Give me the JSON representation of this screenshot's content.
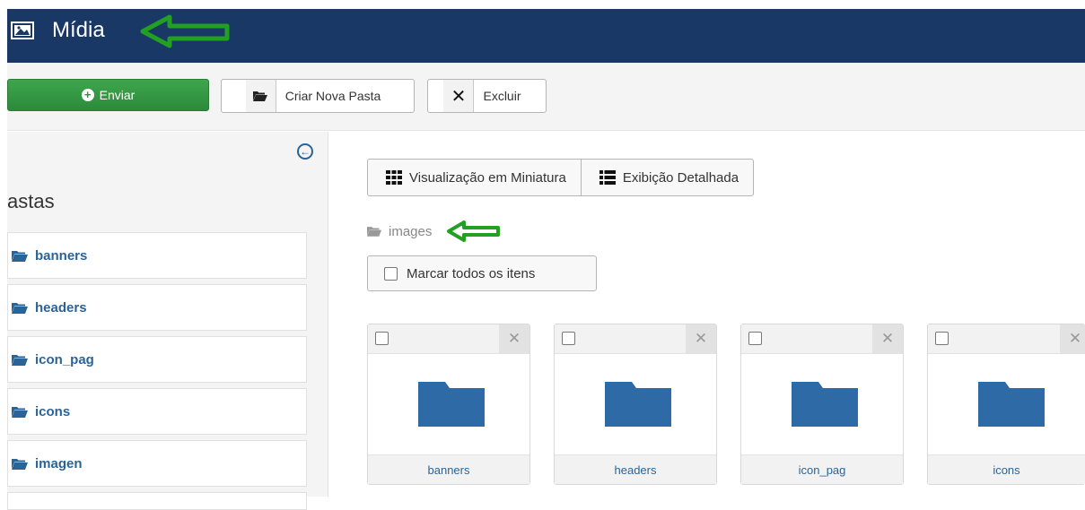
{
  "header": {
    "title": "Mídia"
  },
  "toolbar": {
    "upload_label": "Enviar",
    "new_folder_label": "Criar Nova Pasta",
    "delete_label": "Excluir"
  },
  "sidebar": {
    "heading": "astas",
    "folders": [
      {
        "label": "banners"
      },
      {
        "label": "headers"
      },
      {
        "label": "icon_pag"
      },
      {
        "label": "icons"
      },
      {
        "label": "imagen"
      }
    ]
  },
  "main": {
    "view_thumbnails_label": "Visualização em Miniatura",
    "view_details_label": "Exibição Detalhada",
    "breadcrumb": "images",
    "select_all_label": "Marcar todos os itens",
    "items": [
      {
        "label": "banners"
      },
      {
        "label": "headers"
      },
      {
        "label": "icon_pag"
      },
      {
        "label": "icons"
      }
    ]
  },
  "colors": {
    "header_bg": "#1a3866",
    "primary_button": "#2f8f3d",
    "link": "#2a6496",
    "folder": "#2e6aa5",
    "annotation_arrow": "#22a022"
  }
}
